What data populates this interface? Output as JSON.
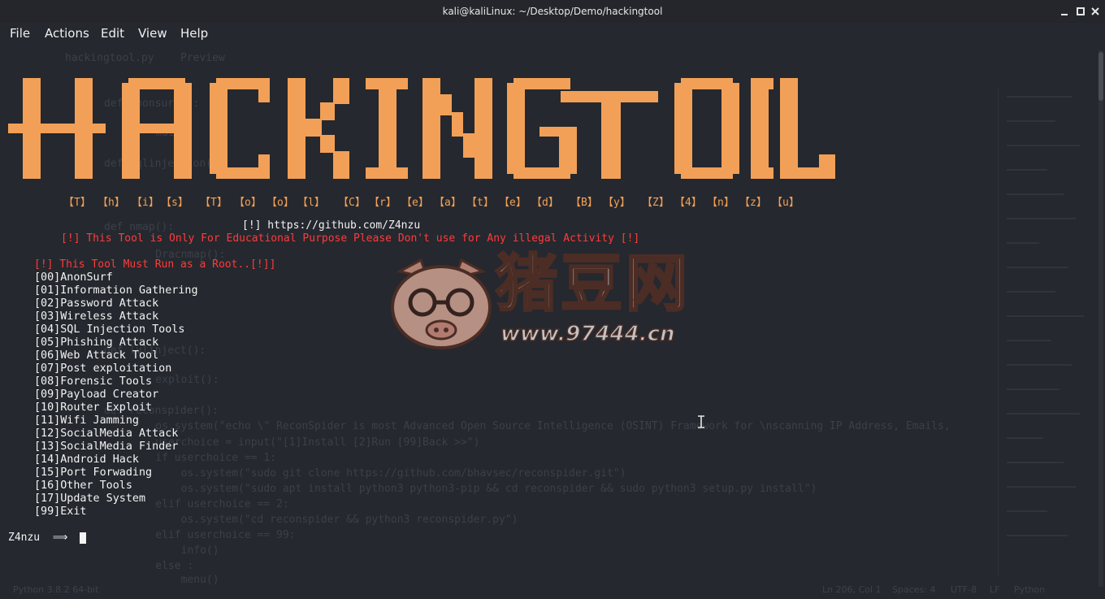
{
  "window": {
    "title": "kali@kaliLinux: ~/Desktop/Demo/hackingtool"
  },
  "menu": [
    "File",
    "Actions",
    "Edit",
    "View",
    "Help"
  ],
  "banner": {
    "ascii_title": "HACKING TOOL",
    "letters": [
      "【T】",
      "【h】",
      "【i】",
      "【s】",
      "【T】",
      "【o】",
      "【o】",
      "【l】",
      "【C】",
      "【r】",
      "【e】",
      "【a】",
      "【t】",
      "【e】",
      "【d】",
      "【B】",
      "【y】",
      "【Z】",
      "【4】",
      "【n】",
      "【z】",
      "【u】"
    ],
    "github": "[!] https://github.com/Z4nzu",
    "disclaimer": "[!] This Tool is Only For Educational Purpose Please Don't use for Any illegal Activity [!]",
    "root_warning": "[!] This Tool Must Run as a Root..[!]]"
  },
  "options": [
    "[00]AnonSurf",
    "[01]Information Gathering",
    "[02]Password Attack",
    "[03]Wireless Attack",
    "[04]SQL Injection Tools",
    "[05]Phishing Attack",
    "[06]Web Attack Tool",
    "[07]Post exploitation",
    "[08]Forensic Tools",
    "[09]Payload Creator",
    "[10]Router Exploit",
    "[11]Wifi Jamming",
    "[12]SocialMedia Attack",
    "[13]SocialMedia Finder",
    "[14]Android Hack",
    "[15]Port Forwading",
    "[16]Other Tools",
    "[17]Update System",
    "[99]Exit"
  ],
  "prompt": "Z4nzu  ⟹",
  "watermark": {
    "name": "猪豆网",
    "url": "www.97444.cn"
  },
  "background_editor": {
    "tabs": [
      "hackingtool.py",
      "Preview"
    ],
    "code_lines": [
      "def anonsurf():",
      "    main()",
      "def sqlinjection():",
      "def nmap():",
      "    Dracnmap():",
      "def lvlinject():",
      "    exploit():",
      "def reconspider():",
      "    os.system(\"echo \\\" ReconSpider is most Advanced Open Source Intelligence (OSINT) Framework for \\nscanning IP Address, Emails,",
      "    userchoice = input(\"[1]Install [2]Run [99]Back >>\")",
      "    if userchoice == 1:",
      "        os.system(\"sudo git clone https://github.com/bhavsec/reconspider.git\")",
      "        os.system(\"sudo apt install python3 python3-pip && cd reconspider && sudo python3 setup.py install\")",
      "    elif userchoice == 2:",
      "        os.system(\"cd reconspider && python3 reconspider.py\")",
      "    elif userchoice == 99:",
      "        info()",
      "    else :",
      "        menu()"
    ],
    "status_left": "Python 3.8.2 64-bit",
    "status_right": [
      "Ln 206, Col 1",
      "Spaces: 4",
      "UTF-8",
      "LF",
      "Python"
    ]
  },
  "colors": {
    "background": "#25282e",
    "banner_orange": "#f2a057",
    "warning_red": "#ff3b3b",
    "text": "#f2f2f2"
  }
}
